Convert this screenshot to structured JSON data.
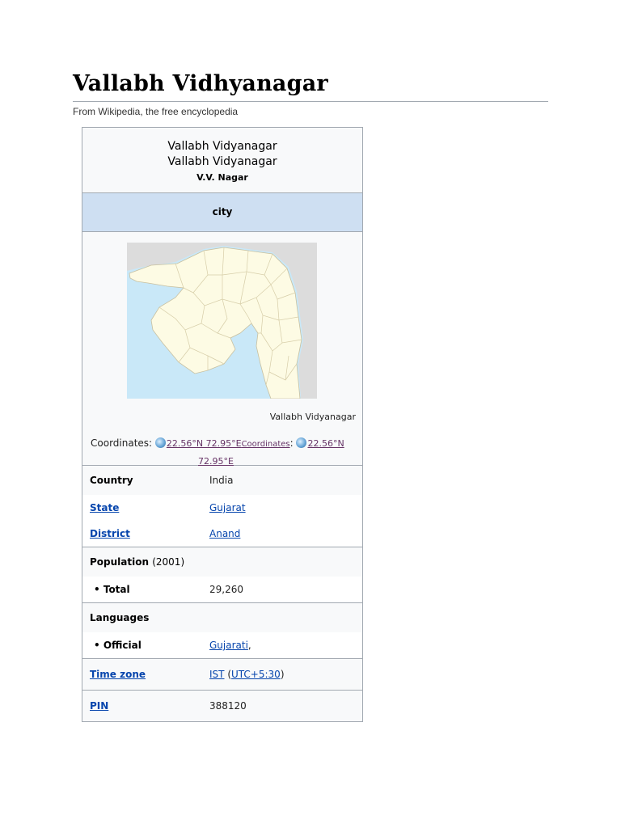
{
  "page": {
    "title": "Vallabh Vidhyanagar",
    "subtitle": "From Wikipedia, the free encyclopedia"
  },
  "infobox": {
    "name_line1": "Vallabh Vidyanagar",
    "name_line2": "Vallabh Vidyanagar",
    "short_name": "V.V. Nagar",
    "settlement_type": "city",
    "map_caption": "Vallabh Vidyanagar",
    "coordinates": {
      "label": "Coordinates:",
      "value1": "22.56°N 72.95°E",
      "link_label": "Coordinates",
      "value2_line1": "22.56°N",
      "value2_line2": "72.95°E"
    },
    "rows": {
      "country": {
        "key": "Country",
        "value": "India"
      },
      "state": {
        "key": "State",
        "value": "Gujarat"
      },
      "district": {
        "key": "District",
        "value": "Anand"
      },
      "population": {
        "key": "Population",
        "year": "(2001)"
      },
      "total": {
        "key": "• Total",
        "value": "29,260"
      },
      "languages": {
        "key": "Languages"
      },
      "official": {
        "key": "• Official",
        "value": "Gujarati",
        "trail": ","
      },
      "timezone": {
        "key": "Time zone",
        "value_ist": "IST",
        "open": "(",
        "value_utc": "UTC+5:30",
        "close": ")"
      },
      "pin": {
        "key": "PIN",
        "value": "388120"
      }
    }
  },
  "colors": {
    "type_band": "#cedff2",
    "link": "#0645ad",
    "visited_link": "#663366",
    "sea": "#c9e8f8",
    "land": "#fdfbe4",
    "neighbor_land": "#dcdcdc"
  }
}
